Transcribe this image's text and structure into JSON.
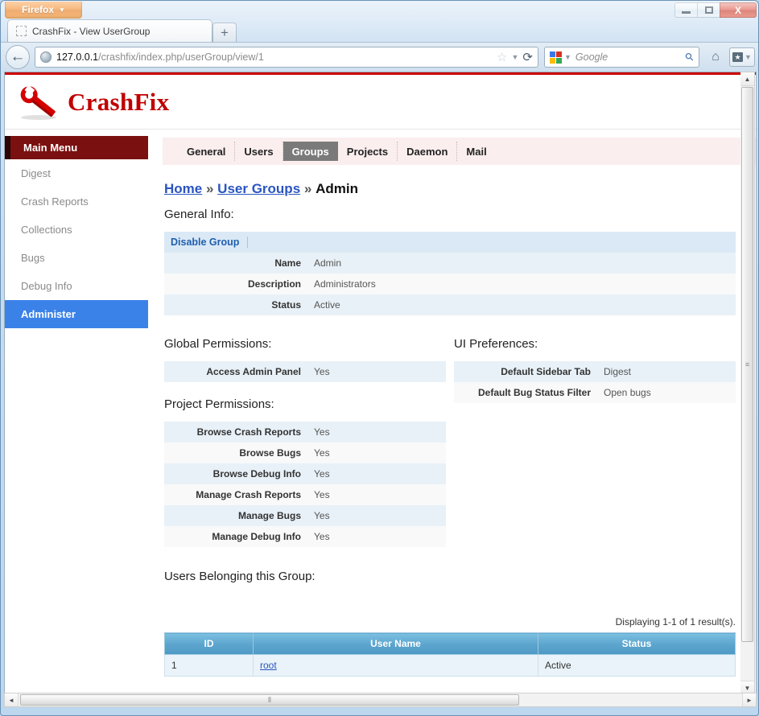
{
  "browser": {
    "app_button": "Firefox",
    "app_button_caret": "▼",
    "window_controls": {
      "minimize": "minimize-icon",
      "maximize": "maximize-icon",
      "close": "X"
    },
    "tab": {
      "title": "CrashFix - View UserGroup",
      "favicon": "blank-favicon",
      "new_tab_label": "+"
    },
    "nav": {
      "back_glyph": "←",
      "url_host": "127.0.0.1",
      "url_path": "/crashfix/index.php/userGroup/view/1",
      "bookmark_star": "☆",
      "dropmarker": "▼",
      "reload_glyph": "⟳",
      "search_engine": "Google",
      "search_placeholder": "Google",
      "magnifier": "⚲",
      "home_glyph": "⌂",
      "bookmarks_star": "★",
      "bookmarks_caret": "▼"
    }
  },
  "site": {
    "brand": "CrashFix",
    "logo_icon": "red-wrench-icon"
  },
  "sidebar": {
    "header": "Main Menu",
    "items": [
      {
        "label": "Digest",
        "active": false
      },
      {
        "label": "Crash Reports",
        "active": false
      },
      {
        "label": "Collections",
        "active": false
      },
      {
        "label": "Bugs",
        "active": false
      },
      {
        "label": "Debug Info",
        "active": false
      },
      {
        "label": "Administer",
        "active": true
      }
    ]
  },
  "admin_tabs": [
    {
      "label": "General",
      "selected": false
    },
    {
      "label": "Users",
      "selected": false
    },
    {
      "label": "Groups",
      "selected": true
    },
    {
      "label": "Projects",
      "selected": false
    },
    {
      "label": "Daemon",
      "selected": false
    },
    {
      "label": "Mail",
      "selected": false
    }
  ],
  "breadcrumb": {
    "home": "Home",
    "sep1": "»",
    "user_groups": "User Groups",
    "sep2": "»",
    "current": "Admin"
  },
  "sections": {
    "general_info_title": "General Info:",
    "global_permissions_title": "Global Permissions:",
    "project_permissions_title": "Project Permissions:",
    "ui_preferences_title": "UI Preferences:",
    "users_title": "Users Belonging this Group:"
  },
  "general_info": {
    "action_link": "Disable Group",
    "rows": [
      {
        "label": "Name",
        "value": "Admin"
      },
      {
        "label": "Description",
        "value": "Administrators"
      },
      {
        "label": "Status",
        "value": "Active"
      }
    ]
  },
  "global_permissions": {
    "rows": [
      {
        "label": "Access Admin Panel",
        "value": "Yes"
      }
    ]
  },
  "project_permissions": {
    "rows": [
      {
        "label": "Browse Crash Reports",
        "value": "Yes"
      },
      {
        "label": "Browse Bugs",
        "value": "Yes"
      },
      {
        "label": "Browse Debug Info",
        "value": "Yes"
      },
      {
        "label": "Manage Crash Reports",
        "value": "Yes"
      },
      {
        "label": "Manage Bugs",
        "value": "Yes"
      },
      {
        "label": "Manage Debug Info",
        "value": "Yes"
      }
    ]
  },
  "ui_preferences": {
    "rows": [
      {
        "label": "Default Sidebar Tab",
        "value": "Digest"
      },
      {
        "label": "Default Bug Status Filter",
        "value": "Open bugs"
      }
    ]
  },
  "users_grid": {
    "results_text": "Displaying 1-1 of 1 result(s).",
    "columns": [
      "ID",
      "User Name",
      "Status"
    ],
    "rows": [
      {
        "id": "1",
        "user_name": "root",
        "status": "Active"
      }
    ]
  },
  "scrollbars": {
    "v_up": "▲",
    "v_down": "▼",
    "v_grip": "≡",
    "h_left": "◄",
    "h_right": "►",
    "h_grip": "⦀"
  },
  "colors": {
    "accent_red": "#cc0000",
    "menu_header": "#7b1010",
    "menu_active": "#3b82e8",
    "tabbar_bg": "#fbeeee",
    "tab_selected": "#7a7a7a",
    "grid_header": "#5ba4cd",
    "link": "#2a55c0"
  }
}
